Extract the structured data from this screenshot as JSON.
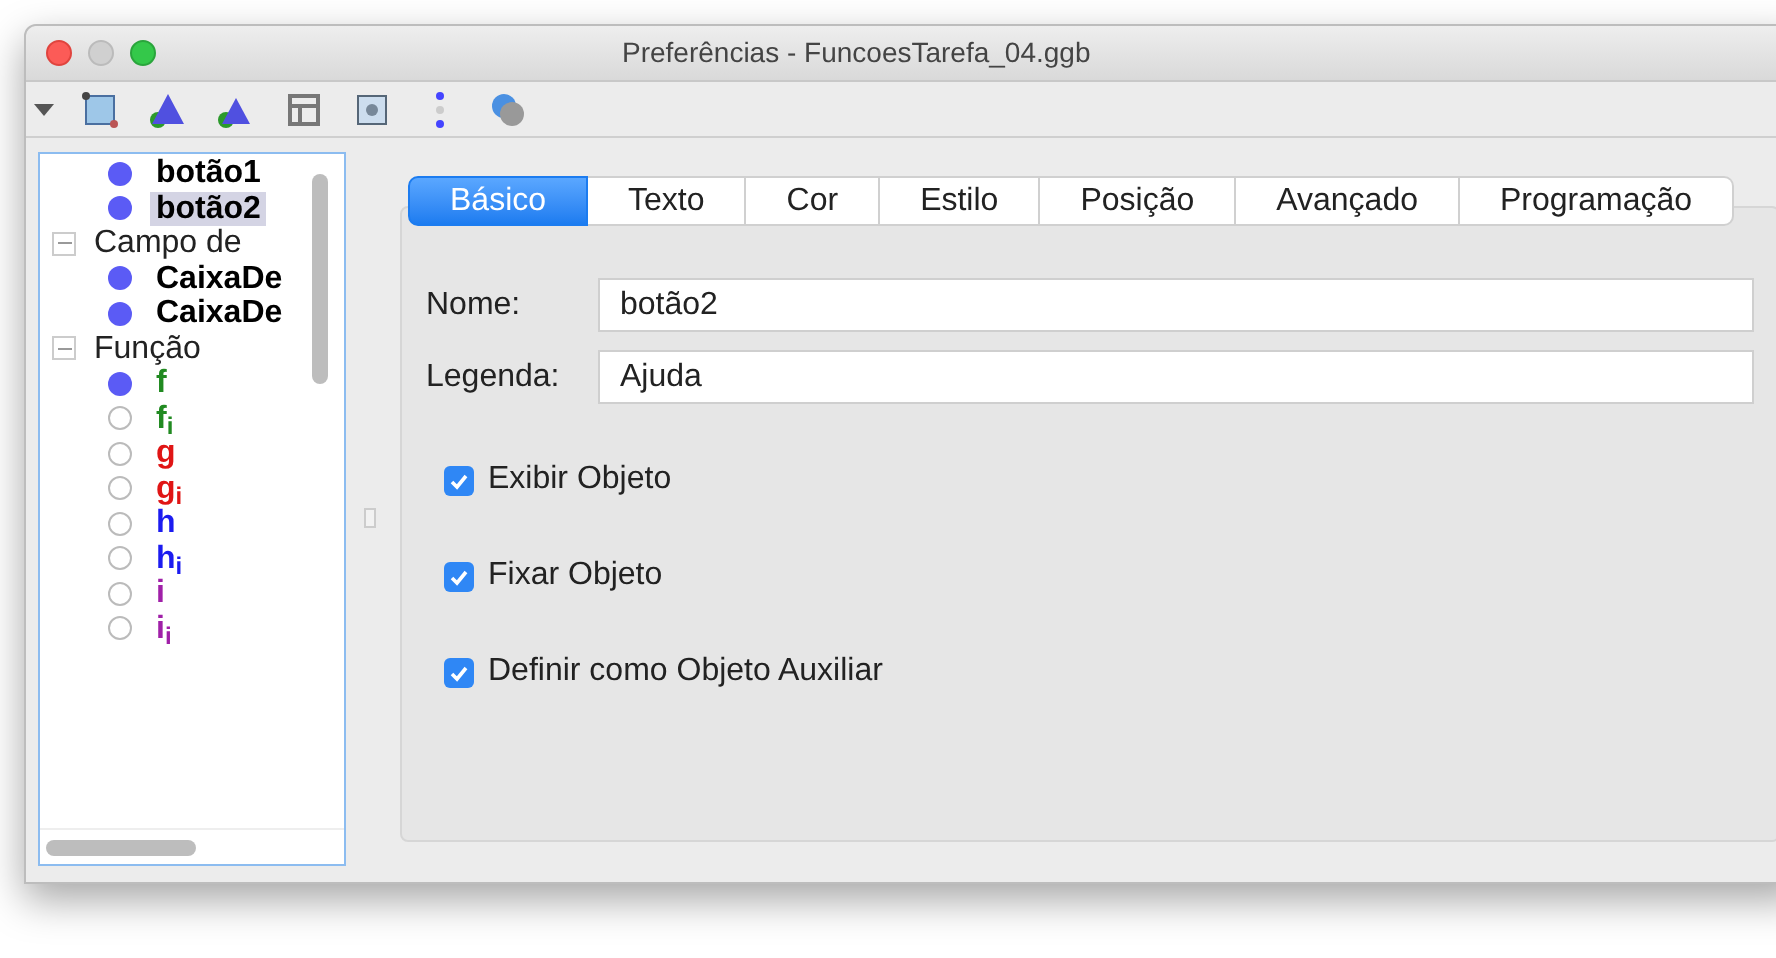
{
  "window": {
    "title": "Preferências - FuncoesTarefa_04.ggb"
  },
  "tree": [
    {
      "children": [
        {
          "label": "botão1",
          "visible": true,
          "selected": false,
          "color": "#000000"
        },
        {
          "label": "botão2",
          "visible": true,
          "selected": true,
          "color": "#000000"
        }
      ]
    },
    {
      "label": "Campo de",
      "expanded": true,
      "children": [
        {
          "label": "CaixaDe",
          "visible": true,
          "selected": false,
          "color": "#000000"
        },
        {
          "label": "CaixaDe",
          "visible": true,
          "selected": false,
          "color": "#000000"
        }
      ]
    },
    {
      "label": "Função",
      "expanded": true,
      "children": [
        {
          "label": "f",
          "visible": true,
          "selected": false,
          "color": "#218a21"
        },
        {
          "label": "f$_{i}$",
          "visible": false,
          "selected": false,
          "color": "#218a21"
        },
        {
          "label": "g",
          "visible": false,
          "selected": false,
          "color": "#e01515"
        },
        {
          "label": "g$_{i}$",
          "visible": false,
          "selected": false,
          "color": "#e01515"
        },
        {
          "label": "h",
          "visible": false,
          "selected": false,
          "color": "#1c1cf0"
        },
        {
          "label": "h$_{i}$",
          "visible": false,
          "selected": false,
          "color": "#1c1cf0"
        },
        {
          "label": "i",
          "visible": false,
          "selected": false,
          "color": "#a020a8"
        },
        {
          "label": "i$_{i}$",
          "visible": false,
          "selected": false,
          "color": "#a020a8"
        }
      ]
    }
  ],
  "tabs": [
    {
      "label": "Básico",
      "selected": true
    },
    {
      "label": "Texto",
      "selected": false
    },
    {
      "label": "Cor",
      "selected": false
    },
    {
      "label": "Estilo",
      "selected": false
    },
    {
      "label": "Posição",
      "selected": false
    },
    {
      "label": "Avançado",
      "selected": false
    },
    {
      "label": "Programação",
      "selected": false
    }
  ],
  "fields": [
    {
      "label": "Nome:",
      "value": "botão2"
    },
    {
      "label": "Legenda:",
      "value": "Ajuda"
    }
  ],
  "checkboxes": [
    {
      "label": "Exibir Objeto",
      "checked": true
    },
    {
      "label": "Fixar Objeto",
      "checked": true
    },
    {
      "label": "Definir como Objeto Auxiliar",
      "checked": true
    }
  ]
}
